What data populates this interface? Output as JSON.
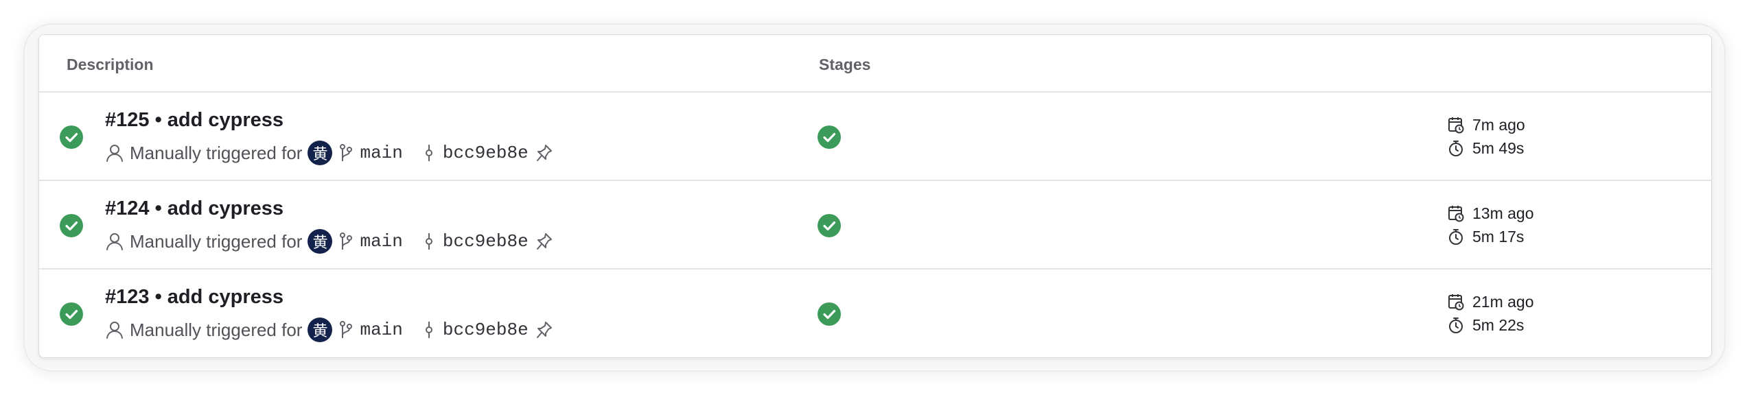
{
  "table": {
    "headers": {
      "description": "Description",
      "stages": "Stages"
    },
    "rows": [
      {
        "status": "passed",
        "title": "#125 • add cypress",
        "trigger_text": "Manually triggered for",
        "avatar_text": "黄",
        "branch": "main",
        "commit": "bcc9eb8e",
        "stage_status": "passed",
        "created": "7m ago",
        "duration": "5m 49s"
      },
      {
        "status": "passed",
        "title": "#124 • add cypress",
        "trigger_text": "Manually triggered for",
        "avatar_text": "黄",
        "branch": "main",
        "commit": "bcc9eb8e",
        "stage_status": "passed",
        "created": "13m ago",
        "duration": "5m 17s"
      },
      {
        "status": "passed",
        "title": "#123 • add cypress",
        "trigger_text": "Manually triggered for",
        "avatar_text": "黄",
        "branch": "main",
        "commit": "bcc9eb8e",
        "stage_status": "passed",
        "created": "21m ago",
        "duration": "5m 22s"
      }
    ]
  },
  "colors": {
    "success": "#3d9b5a",
    "avatar_bg": "#13224a"
  },
  "icons": {
    "status": "check-circle-icon",
    "user": "user-icon",
    "branch": "branch-icon",
    "commit": "commit-icon",
    "pin": "pin-icon",
    "created": "calendar-clock-icon",
    "duration": "stopwatch-icon"
  }
}
